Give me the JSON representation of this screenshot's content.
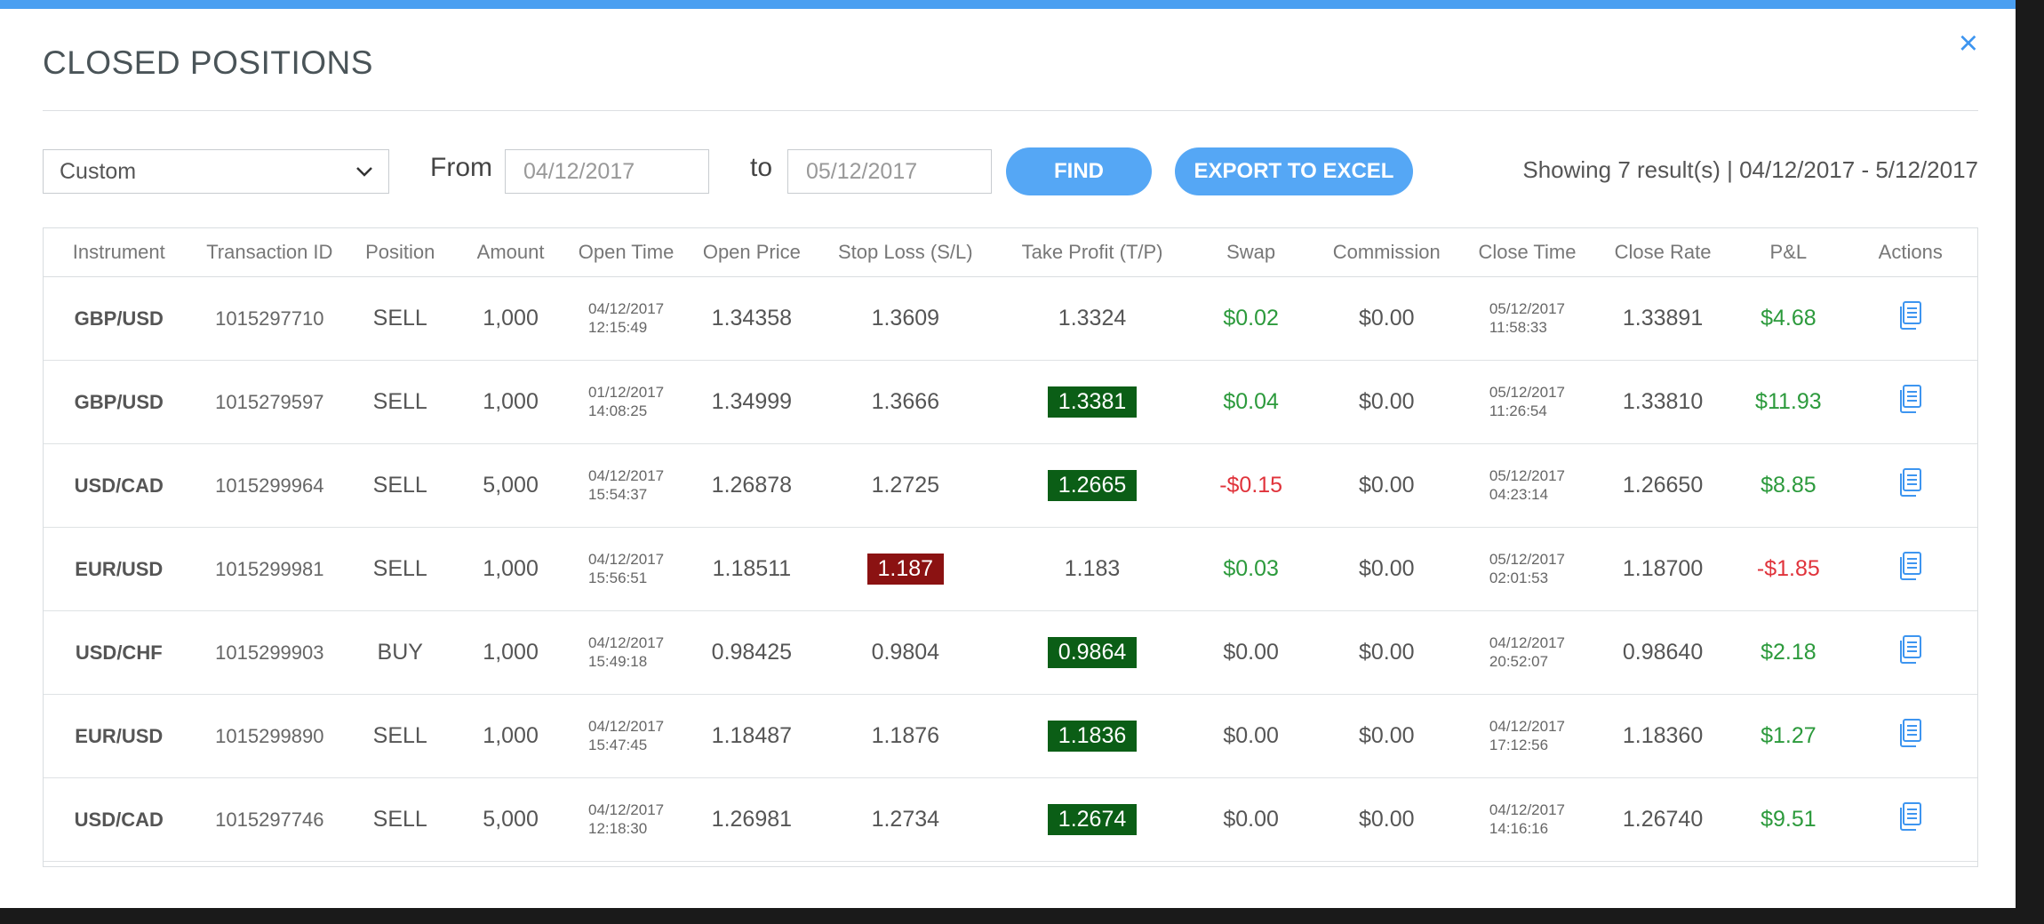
{
  "dialog": {
    "title": "CLOSED POSITIONS",
    "close_glyph": "×"
  },
  "toolbar": {
    "range_select": "Custom",
    "from_label": "From",
    "from_value": "04/12/2017",
    "to_label": "to",
    "to_value": "05/12/2017",
    "find_label": "FIND",
    "export_label": "EXPORT TO EXCEL",
    "summary": "Showing 7 result(s) | 04/12/2017 - 5/12/2017"
  },
  "colors": {
    "accent": "#4a9ff1",
    "button": "#55a7f5",
    "tp_highlight": "#0b5e16",
    "sl_highlight": "#8b1212",
    "positive": "#2c9a3c",
    "negative": "#e0333b"
  },
  "table": {
    "columns": [
      "Instrument",
      "Transaction ID",
      "Position",
      "Amount",
      "Open Time",
      "Open Price",
      "Stop Loss (S/L)",
      "Take Profit (T/P)",
      "Swap",
      "Commission",
      "Close Time",
      "Close Rate",
      "P&L",
      "Actions"
    ],
    "rows": [
      {
        "instrument": "GBP/USD",
        "txid": "1015297710",
        "position": "SELL",
        "amount": "1,000",
        "open_date": "04/12/2017",
        "open_time": "12:15:49",
        "open_price": "1.34358",
        "sl": "1.3609",
        "tp": "1.3324",
        "swap": "$0.02",
        "commission": "$0.00",
        "close_date": "05/12/2017",
        "close_time": "11:58:33",
        "close_rate": "1.33891",
        "pnl": "$4.68"
      },
      {
        "instrument": "GBP/USD",
        "txid": "1015279597",
        "position": "SELL",
        "amount": "1,000",
        "open_date": "01/12/2017",
        "open_time": "14:08:25",
        "open_price": "1.34999",
        "sl": "1.3666",
        "tp": "1.3381",
        "swap": "$0.04",
        "commission": "$0.00",
        "close_date": "05/12/2017",
        "close_time": "11:26:54",
        "close_rate": "1.33810",
        "pnl": "$11.93"
      },
      {
        "instrument": "USD/CAD",
        "txid": "1015299964",
        "position": "SELL",
        "amount": "5,000",
        "open_date": "04/12/2017",
        "open_time": "15:54:37",
        "open_price": "1.26878",
        "sl": "1.2725",
        "tp": "1.2665",
        "swap": "-$0.15",
        "commission": "$0.00",
        "close_date": "05/12/2017",
        "close_time": "04:23:14",
        "close_rate": "1.26650",
        "pnl": "$8.85"
      },
      {
        "instrument": "EUR/USD",
        "txid": "1015299981",
        "position": "SELL",
        "amount": "1,000",
        "open_date": "04/12/2017",
        "open_time": "15:56:51",
        "open_price": "1.18511",
        "sl": "1.187",
        "tp": "1.183",
        "swap": "$0.03",
        "commission": "$0.00",
        "close_date": "05/12/2017",
        "close_time": "02:01:53",
        "close_rate": "1.18700",
        "pnl": "-$1.85"
      },
      {
        "instrument": "USD/CHF",
        "txid": "1015299903",
        "position": "BUY",
        "amount": "1,000",
        "open_date": "04/12/2017",
        "open_time": "15:49:18",
        "open_price": "0.98425",
        "sl": "0.9804",
        "tp": "0.9864",
        "swap": "$0.00",
        "commission": "$0.00",
        "close_date": "04/12/2017",
        "close_time": "20:52:07",
        "close_rate": "0.98640",
        "pnl": "$2.18"
      },
      {
        "instrument": "EUR/USD",
        "txid": "1015299890",
        "position": "SELL",
        "amount": "1,000",
        "open_date": "04/12/2017",
        "open_time": "15:47:45",
        "open_price": "1.18487",
        "sl": "1.1876",
        "tp": "1.1836",
        "swap": "$0.00",
        "commission": "$0.00",
        "close_date": "04/12/2017",
        "close_time": "17:12:56",
        "close_rate": "1.18360",
        "pnl": "$1.27"
      },
      {
        "instrument": "USD/CAD",
        "txid": "1015297746",
        "position": "SELL",
        "amount": "5,000",
        "open_date": "04/12/2017",
        "open_time": "12:18:30",
        "open_price": "1.26981",
        "sl": "1.2734",
        "tp": "1.2674",
        "swap": "$0.00",
        "commission": "$0.00",
        "close_date": "04/12/2017",
        "close_time": "14:16:16",
        "close_rate": "1.26740",
        "pnl": "$9.51"
      }
    ],
    "highlights": [
      {
        "row": 1,
        "field": "tp",
        "kind": "green"
      },
      {
        "row": 2,
        "field": "tp",
        "kind": "green"
      },
      {
        "row": 3,
        "field": "sl",
        "kind": "red"
      },
      {
        "row": 4,
        "field": "tp",
        "kind": "green"
      },
      {
        "row": 5,
        "field": "tp",
        "kind": "green"
      },
      {
        "row": 6,
        "field": "tp",
        "kind": "green"
      }
    ],
    "row_action_icon": "document-icon"
  }
}
